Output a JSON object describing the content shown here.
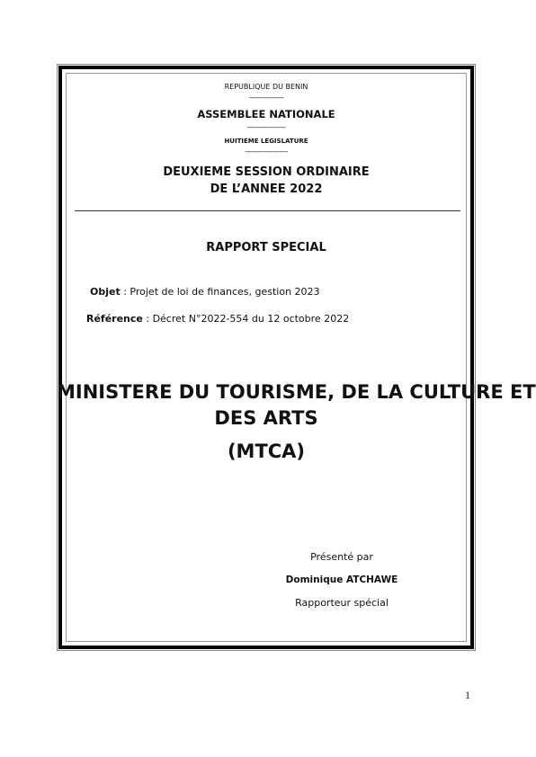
{
  "header": {
    "republic": "REPUBLIQUE DU BENIN",
    "sep1": "----------------",
    "assembly": "ASSEMBLEE NATIONALE",
    "sep2": "------------------",
    "legislature": "HUITIEME LEGISLATURE",
    "sep3": "--------------------",
    "session_line1": "DEUXIEME SESSION ORDINAIRE",
    "session_line2": "DE L’ANNEE 2022"
  },
  "report_title": "RAPPORT SPECIAL",
  "objet": {
    "label": "Objet",
    "value": " : Projet de loi de finances, gestion 2023"
  },
  "reference": {
    "label": "Référence",
    "value": " : Décret N°2022-554 du 12 octobre 2022"
  },
  "ministry": {
    "line1": "MINISTERE DU TOURISME, DE LA CULTURE ET",
    "line2": "DES ARTS",
    "acronym": "(MTCA)"
  },
  "presenter": {
    "intro": "Présenté par",
    "name": "Dominique ATCHAWE",
    "role": "Rapporteur spécial"
  },
  "page_number": "1"
}
